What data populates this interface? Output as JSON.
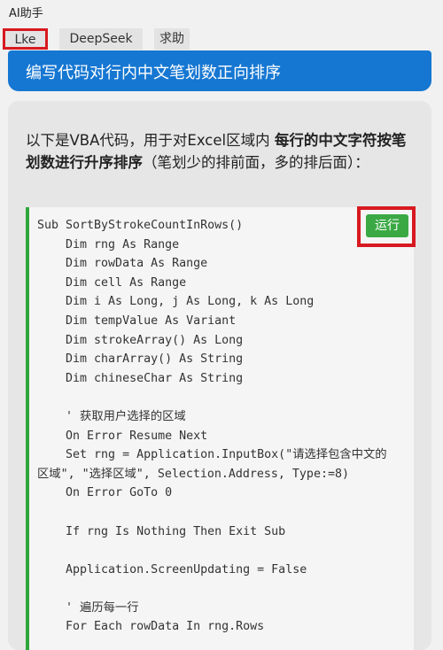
{
  "window": {
    "title": "AI助手"
  },
  "tabs": [
    {
      "label": "Lke",
      "active": true
    },
    {
      "label": "DeepSeek",
      "active": false
    },
    {
      "label": "求助",
      "active": false
    }
  ],
  "prompt": {
    "text": "编写代码对行内中文笔划数正向排序"
  },
  "answer": {
    "intro_1": "以下是VBA代码，用于对Excel区域内 ",
    "intro_bold": "每行的中文字符按笔划数进行升序排序",
    "intro_2": "（笔划少的排前面，多的排后面）：",
    "run_label": "运行",
    "code_lines": [
      "Sub SortByStrokeCountInRows()",
      "    Dim rng As Range",
      "    Dim rowData As Range",
      "    Dim cell As Range",
      "    Dim i As Long, j As Long, k As Long",
      "    Dim tempValue As Variant",
      "    Dim strokeArray() As Long",
      "    Dim charArray() As String",
      "    Dim chineseChar As String",
      "",
      "    ' 获取用户选择的区域",
      "    On Error Resume Next",
      "    Set rng = Application.InputBox(\"请选择包含中文的",
      "区域\", \"选择区域\", Selection.Address, Type:=8)",
      "    On Error GoTo 0",
      "",
      "    If rng Is Nothing Then Exit Sub",
      "",
      "    Application.ScreenUpdating = False",
      "",
      "    ' 遍历每一行",
      "    For Each rowData In rng.Rows"
    ]
  },
  "colors": {
    "accent": "#1677d2",
    "run_button": "#3aa944",
    "highlight": "#d71920"
  }
}
